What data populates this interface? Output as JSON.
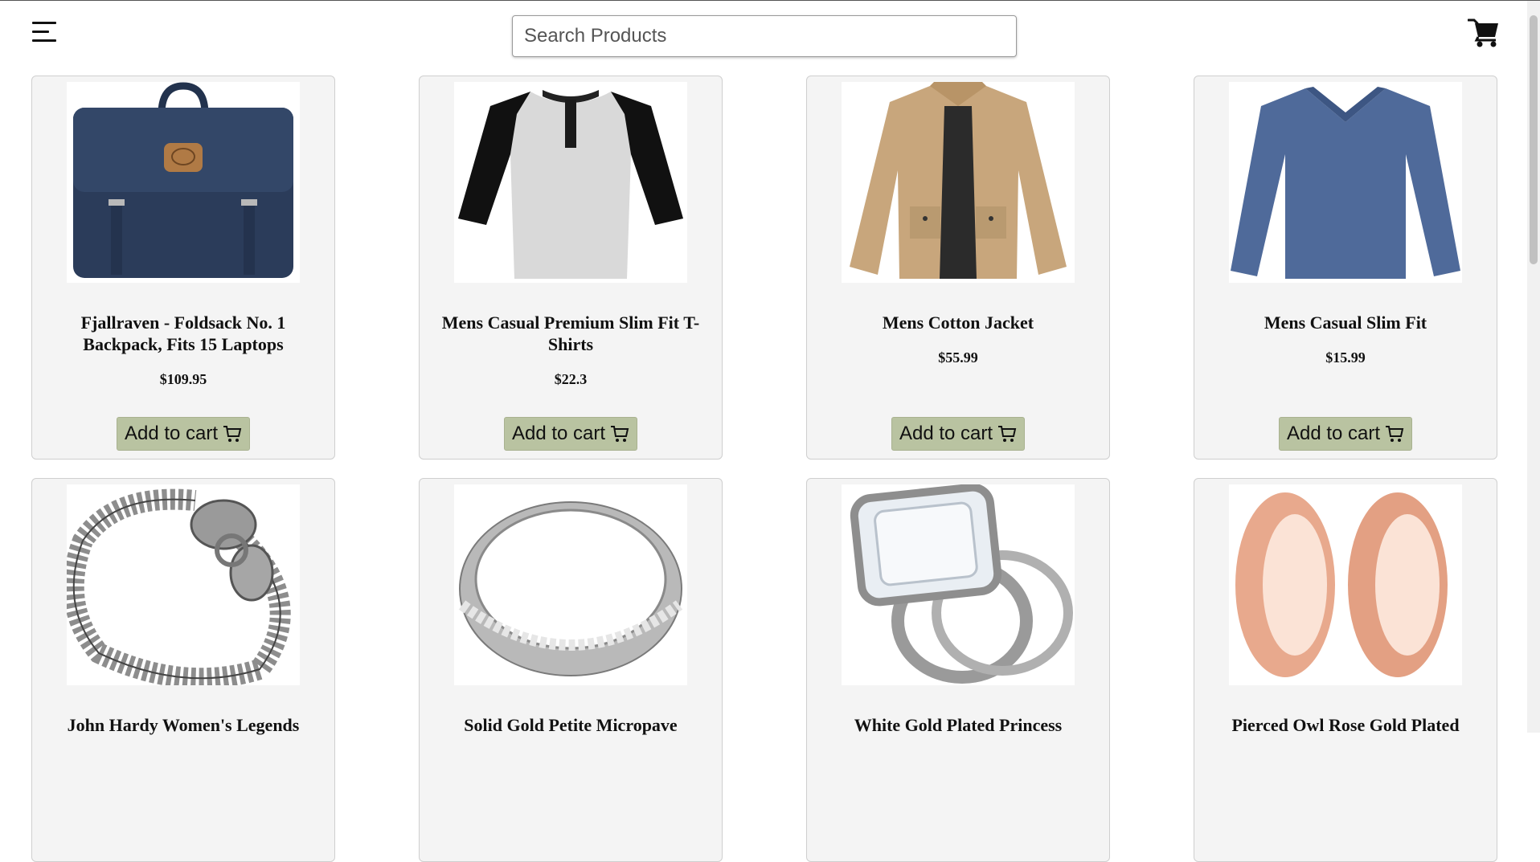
{
  "search": {
    "placeholder": "Search Products"
  },
  "icons": {
    "menu": "hamburger-menu-icon",
    "cart": "shopping-cart-icon"
  },
  "colors": {
    "button_bg": "#b9c3a1",
    "card_bg": "#f4f4f4"
  },
  "products": [
    {
      "title": "Fjallraven - Foldsack No. 1 Backpack, Fits 15 Laptops",
      "price": "$109.95",
      "button": "Add to cart",
      "image": "navy-backpack"
    },
    {
      "title": "Mens Casual Premium Slim Fit T-Shirts",
      "price": "$22.3",
      "button": "Add to cart",
      "image": "raglan-tshirt"
    },
    {
      "title": "Mens Cotton Jacket",
      "price": "$55.99",
      "button": "Add to cart",
      "image": "khaki-jacket"
    },
    {
      "title": "Mens Casual Slim Fit",
      "price": "$15.99",
      "button": "Add to cart",
      "image": "blue-longsleeve"
    },
    {
      "title": "John Hardy Women's Legends",
      "price": "",
      "button": "",
      "image": "dragon-bracelet"
    },
    {
      "title": "Solid Gold Petite Micropave",
      "price": "",
      "button": "",
      "image": "silver-band-ring"
    },
    {
      "title": "White Gold Plated Princess",
      "price": "",
      "button": "",
      "image": "diamond-ring-set"
    },
    {
      "title": "Pierced Owl Rose Gold Plated",
      "price": "",
      "button": "",
      "image": "rose-gold-plugs"
    }
  ]
}
